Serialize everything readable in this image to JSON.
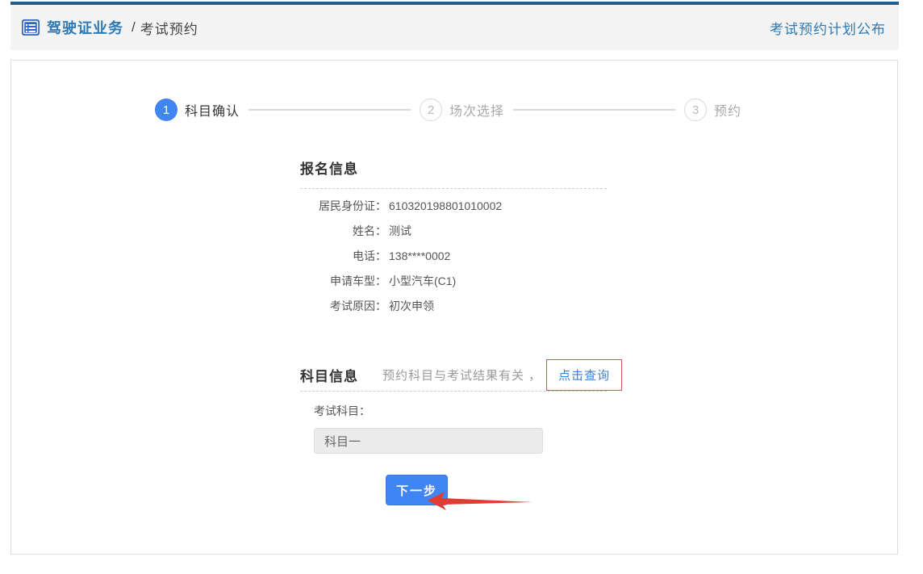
{
  "header": {
    "title": "驾驶证业务",
    "separator": "/",
    "current": "考试预约",
    "right_link": "考试预约计划公布"
  },
  "steps": [
    {
      "num": "1",
      "label": "科目确认"
    },
    {
      "num": "2",
      "label": "场次选择"
    },
    {
      "num": "3",
      "label": "预约"
    }
  ],
  "registration": {
    "heading": "报名信息",
    "fields": [
      {
        "label": "居民身份证：",
        "value": "610320198801010002"
      },
      {
        "label": "姓名：",
        "value": "测试"
      },
      {
        "label": "电话：",
        "value": "138****0002"
      },
      {
        "label": "申请车型：",
        "value": "小型汽车(C1)"
      },
      {
        "label": "考试原因：",
        "value": "初次申领"
      }
    ]
  },
  "subject": {
    "heading": "科目信息",
    "hint": "预约科目与考试结果有关 ，",
    "query_link": "点击查询",
    "exam_label": "考试科目：",
    "exam_value": "科目一"
  },
  "actions": {
    "next_label": "下一步"
  },
  "icons": {
    "header_icon": "list-icon",
    "annotation": "red-arrow"
  },
  "colors": {
    "topbar_blue": "#235e91",
    "header_bg": "#f4f4f4",
    "header_link_blue": "#2e79b3",
    "primary_blue": "#4184f3",
    "link_blue": "#4080d0",
    "annotation_red": "#e03c31"
  }
}
